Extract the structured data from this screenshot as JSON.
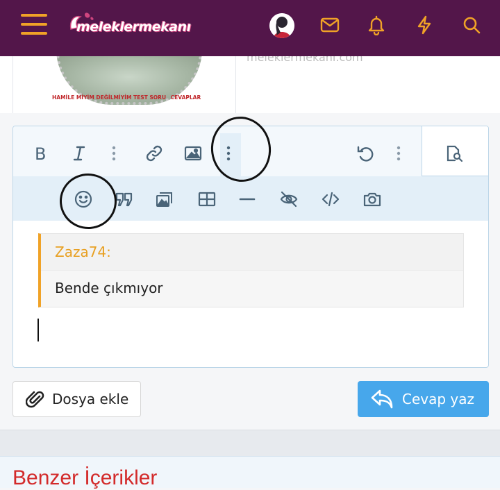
{
  "header": {
    "logo_text": "meleklermekanı",
    "icons": [
      "menu-icon",
      "envelope-icon",
      "bell-icon",
      "bolt-icon",
      "search-icon"
    ],
    "accent": "#f0a227",
    "background": "#53164a"
  },
  "background_post": {
    "caption": "HAMİLE MİYİM DEĞİLMİYİM TEST SORU",
    "caption_suffix": "CEVAPLAR",
    "url": "meleklermekani.com"
  },
  "editor": {
    "toolbar_row1": [
      "bold-icon",
      "italic-icon",
      "more-text-icon",
      "link-icon",
      "image-icon",
      "more-insert-icon",
      "undo-icon",
      "more-icon",
      "preview-icon"
    ],
    "toolbar_row2": [
      "smilie-icon",
      "quote-icon",
      "media-icon",
      "table-icon",
      "horizontal-line-icon",
      "spoiler-icon",
      "code-icon",
      "camera-icon"
    ],
    "quote": {
      "author": "Zaza74:",
      "text": "Bende çıkmıyor"
    }
  },
  "actions": {
    "attach_label": "Dosya ekle",
    "reply_label": "Cevap yaz",
    "reply_color": "#47a7eb"
  },
  "similar": {
    "title": "Benzer İçerikler"
  }
}
